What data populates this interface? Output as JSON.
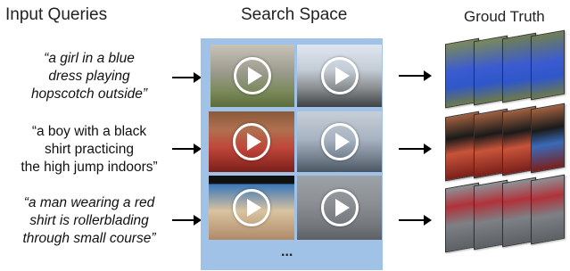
{
  "headings": {
    "input": "Input Queries",
    "search": "Search Space",
    "truth": "Groud Truth"
  },
  "queries": [
    {
      "line1": "“a girl in a blue",
      "line2": "dress playing",
      "line3": "hopscotch outside”"
    },
    {
      "line1": "“a boy with a black",
      "line2": "shirt practicing",
      "line3": "the high jump indoors”"
    },
    {
      "line1": "“a man wearing a red",
      "line2": "shirt is rollerblading",
      "line3": "through small course”"
    }
  ],
  "search_space": {
    "ellipsis": "...",
    "colors": {
      "panel": "#9fc2e6",
      "play_ring": "#ffffff"
    }
  }
}
